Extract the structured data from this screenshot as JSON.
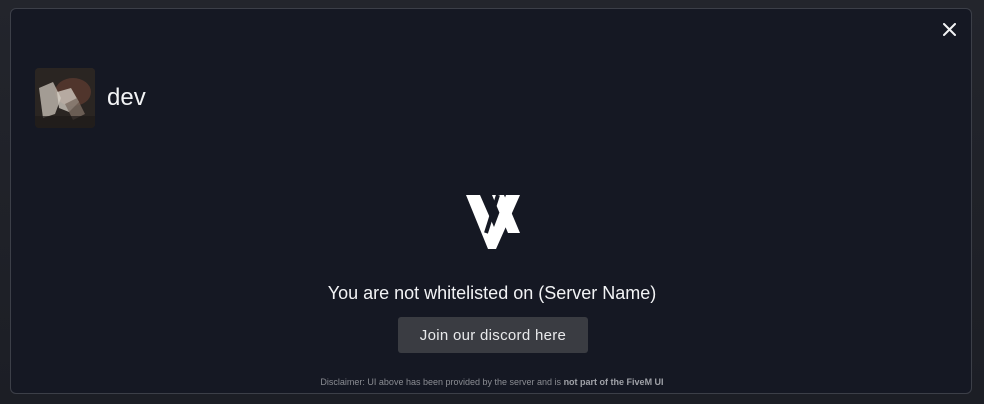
{
  "modal": {
    "close_icon": "close-icon",
    "server": {
      "name": "dev",
      "avatar": "server-avatar-image"
    },
    "logo_icon": "server-logo-icon",
    "message": "You are not whitelisted on (Server Name)",
    "discord_button_label": "Join our discord here",
    "disclaimer": {
      "prefix": "Disclaimer: UI above has been provided by the server and is",
      "emphasis": "not part of the FiveM UI"
    }
  },
  "colors": {
    "modal_bg": "#151823",
    "button_bg": "#3a3c42",
    "text": "#f2f3f5"
  }
}
